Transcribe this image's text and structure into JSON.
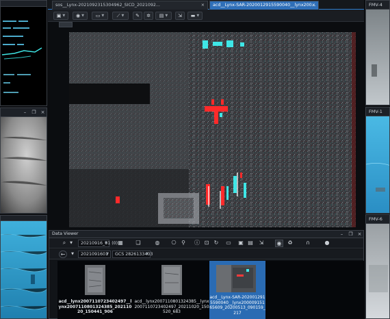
{
  "tabs": [
    {
      "label": "sos__Lynx-20210923153049​62_SICD_2021092...",
      "close": "×"
    },
    {
      "label": "acd__Lynx-SAR-2020012915590040__lynx200...",
      "close": "×"
    }
  ],
  "side_windows": {
    "fmv4_title": "FMV-4",
    "fmv1_title": "FMV-1",
    "fmv6_title": "FMV-6"
  },
  "data_viewer": {
    "title": "Data Viewer",
    "date_combo": "20210916_01 (0)",
    "folder_combo": "20210916​01",
    "crs_combo": "GCS 2826133403",
    "thumbnails": [
      {
        "label": "acd__lynx20071107234024​97__lynx200711080132438​5_20211020_150441_906",
        "selected": false
      },
      {
        "label": "acd__lynx2007110801324385__lynx20071107234024​97_20211020_150520_683",
        "selected": false
      },
      {
        "label": "acd__Lynx-SAR-2020012915590040__lynx2000091516​5609_20200513_090159_217",
        "selected": true
      }
    ]
  },
  "colors": {
    "accent": "#2f7fd0",
    "selection": "#2a6bb3",
    "sar_cyan": "#3fe6e6",
    "sar_red": "#ff2a2a",
    "fmv_blue": "#3aa7d6"
  }
}
